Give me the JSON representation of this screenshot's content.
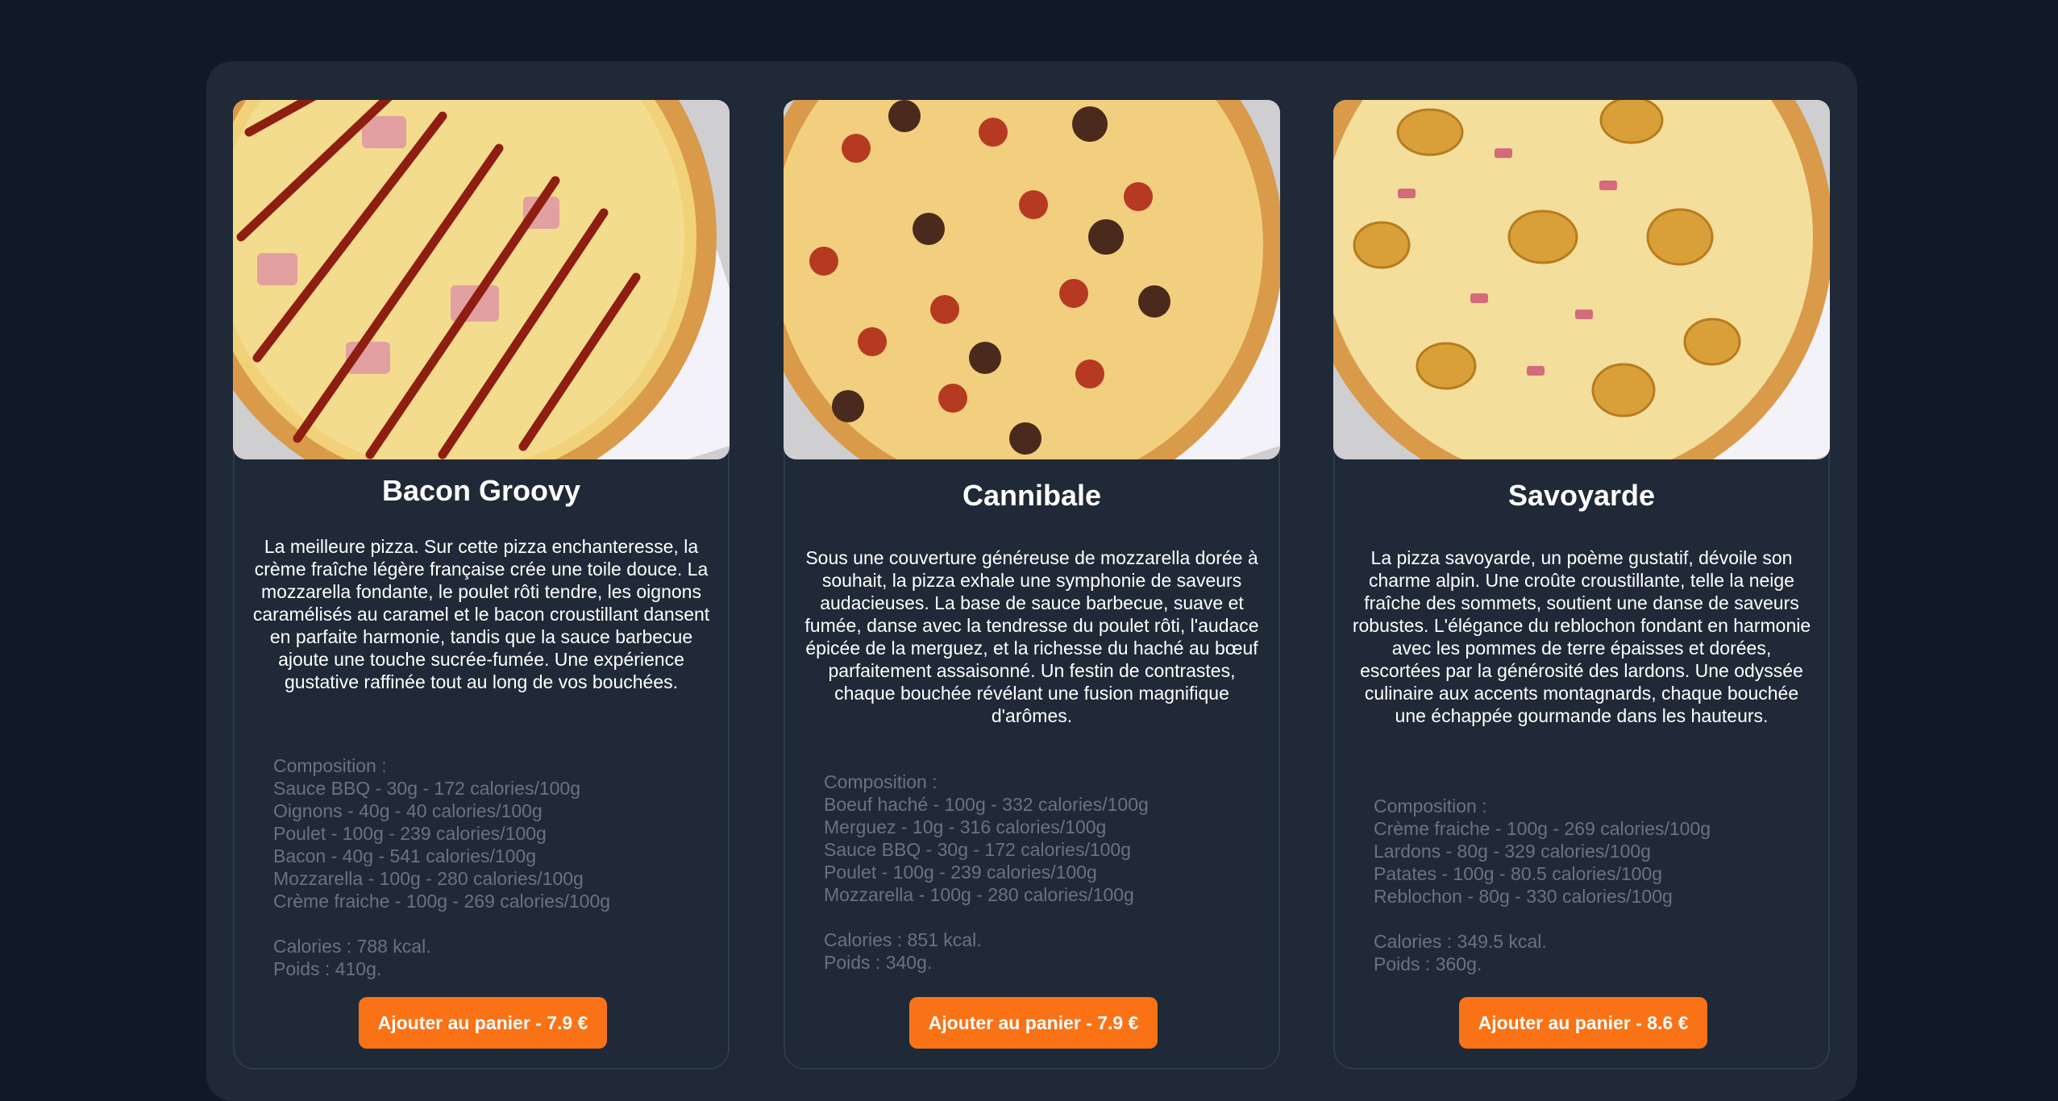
{
  "colors": {
    "page_background": "#111827",
    "panel_background": "#1f2937",
    "accent": "#f97316",
    "muted_text": "#6b7280"
  },
  "products": [
    {
      "name": "Bacon Groovy",
      "image_icon": "pizza-bacon-groovy-photo",
      "description": "La meilleure pizza. Sur cette pizza enchanteresse, la crème fraîche légère française crée une toile douce. La mozzarella fondante, le poulet rôti tendre, les oignons caramélisés au caramel et le bacon croustillant dansent en parfaite harmonie, tandis que la sauce barbecue ajoute une touche sucrée-fumée. Une expérience gustative raffinée tout au long de vos bouchées.",
      "composition_label": "Composition :",
      "ingredients": [
        "Sauce BBQ - 30g - 172 calories/100g",
        "Oignons - 40g - 40 calories/100g",
        "Poulet - 100g - 239 calories/100g",
        "Bacon - 40g - 541 calories/100g",
        "Mozzarella - 100g - 280 calories/100g",
        "Crème fraiche - 100g - 269 calories/100g"
      ],
      "calories": "Calories : 788 kcal.",
      "weight": "Poids : 410g.",
      "button_label": "Ajouter au panier - 7.9 €"
    },
    {
      "name": "Cannibale",
      "image_icon": "pizza-cannibale-photo",
      "description": "Sous une couverture généreuse de mozzarella dorée à souhait, la pizza exhale une symphonie de saveurs audacieuses. La base de sauce barbecue, suave et fumée, danse avec la tendresse du poulet rôti, l'audace épicée de la merguez, et la richesse du haché au bœuf parfaitement assaisonné. Un festin de contrastes, chaque bouchée révélant une fusion magnifique d'arômes.",
      "composition_label": "Composition :",
      "ingredients": [
        "Boeuf haché - 100g - 332 calories/100g",
        "Merguez - 10g - 316 calories/100g",
        "Sauce BBQ - 30g - 172 calories/100g",
        "Poulet - 100g - 239 calories/100g",
        "Mozzarella - 100g - 280 calories/100g"
      ],
      "calories": "Calories : 851 kcal.",
      "weight": "Poids : 340g.",
      "button_label": "Ajouter au panier - 7.9 €"
    },
    {
      "name": "Savoyarde",
      "image_icon": "pizza-savoyarde-photo",
      "description": "La pizza savoyarde, un poème gustatif, dévoile son charme alpin. Une croûte croustillante, telle la neige fraîche des sommets, soutient une danse de saveurs robustes. L'élégance du reblochon fondant en harmonie avec les pommes de terre épaisses et dorées, escortées par la générosité des lardons. Une odyssée culinaire aux accents montagnards, chaque bouchée une échappée gourmande dans les hauteurs.",
      "composition_label": "Composition :",
      "ingredients": [
        "Crème fraiche - 100g - 269 calories/100g",
        "Lardons - 80g - 329 calories/100g",
        "Patates - 100g - 80.5 calories/100g",
        "Reblochon - 80g - 330 calories/100g"
      ],
      "calories": "Calories : 349.5 kcal.",
      "weight": "Poids : 360g.",
      "button_label": "Ajouter au panier - 8.6 €"
    }
  ]
}
